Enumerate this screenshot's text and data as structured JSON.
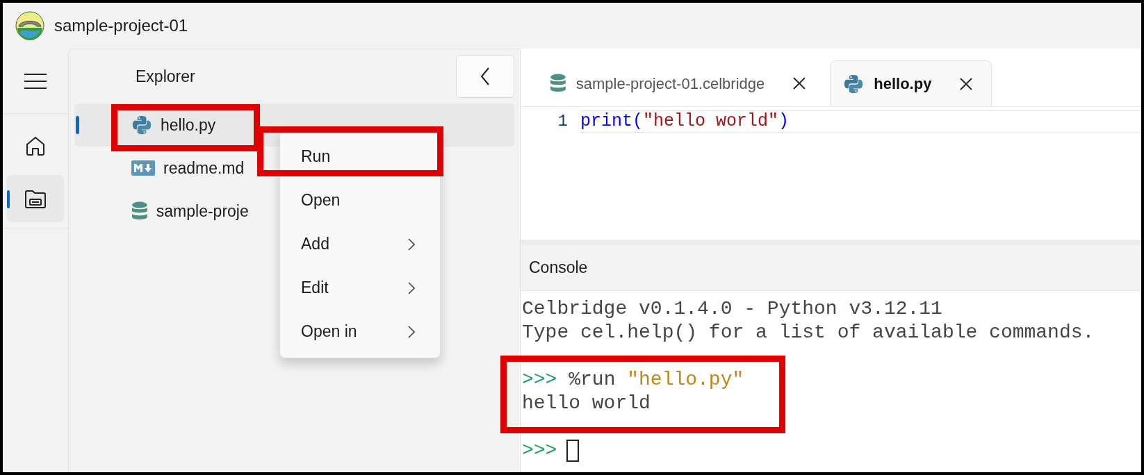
{
  "window": {
    "title": "sample-project-01"
  },
  "nav_rail": [
    {
      "kind": "menu",
      "selected": false
    },
    {
      "kind": "home",
      "selected": false
    },
    {
      "kind": "folder",
      "selected": true
    }
  ],
  "explorer": {
    "title": "Explorer",
    "files": [
      {
        "name": "hello.py",
        "kind": "python",
        "selected": true
      },
      {
        "name": "readme.md",
        "kind": "markdown",
        "selected": false
      },
      {
        "name": "sample-proje",
        "kind": "database",
        "selected": false
      }
    ]
  },
  "context_menu": [
    {
      "label": "Run",
      "submenu": false
    },
    {
      "label": "Open",
      "submenu": false
    },
    {
      "label": "Add",
      "submenu": true
    },
    {
      "label": "Edit",
      "submenu": true
    },
    {
      "label": "Open in",
      "submenu": true
    }
  ],
  "editor": {
    "tabs": [
      {
        "label": "sample-project-01.celbridge",
        "kind": "database",
        "selected": false
      },
      {
        "label": "hello.py",
        "kind": "python",
        "selected": true
      }
    ],
    "lines": [
      {
        "number": "1",
        "tokens": [
          {
            "kind": "keyword",
            "text": "print("
          },
          {
            "kind": "string",
            "text": "\"hello world\""
          },
          {
            "kind": "keyword",
            "text": ")"
          }
        ]
      }
    ]
  },
  "console": {
    "title": "Console",
    "lines": [
      {
        "segments": [
          {
            "kind": "output",
            "text": "Celbridge v0.1.4.0 - Python v3.12.11"
          }
        ]
      },
      {
        "segments": [
          {
            "kind": "output",
            "text": "Type cel.help() for a list of available commands."
          }
        ]
      },
      {
        "kind": "blank"
      },
      {
        "segments": [
          {
            "kind": "prompt",
            "text": ">>>"
          },
          {
            "kind": "output",
            "text": " %run "
          },
          {
            "kind": "string",
            "text": "\"hello.py\""
          }
        ]
      },
      {
        "segments": [
          {
            "kind": "output",
            "text": "hello world"
          }
        ]
      },
      {
        "kind": "blank"
      },
      {
        "segments": [
          {
            "kind": "prompt",
            "text": ">>>"
          }
        ],
        "cursor": true
      }
    ]
  }
}
